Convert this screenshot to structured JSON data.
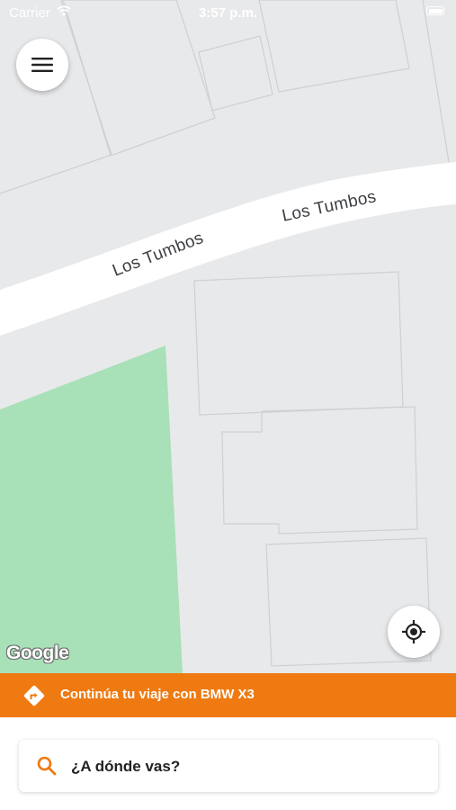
{
  "status_bar": {
    "carrier": "Carrier",
    "time": "3:57 p.m."
  },
  "map": {
    "street_labels": [
      "Los Tumbos",
      "Los Tumbos"
    ],
    "attribution": "Google",
    "colors": {
      "background": "#e8e9eb",
      "road": "#ffffff",
      "park": "#a8e0b8",
      "building_outline": "#cdd0d4"
    }
  },
  "controls": {
    "menu_icon": "hamburger-icon",
    "locate_icon": "crosshair-icon"
  },
  "trip_banner": {
    "text": "Continúa tu viaje con BMW X3",
    "icon": "directions-icon",
    "color": "#ef7a11"
  },
  "search": {
    "placeholder": "¿A dónde vas?",
    "icon": "search-icon",
    "icon_color": "#ef7a11"
  }
}
